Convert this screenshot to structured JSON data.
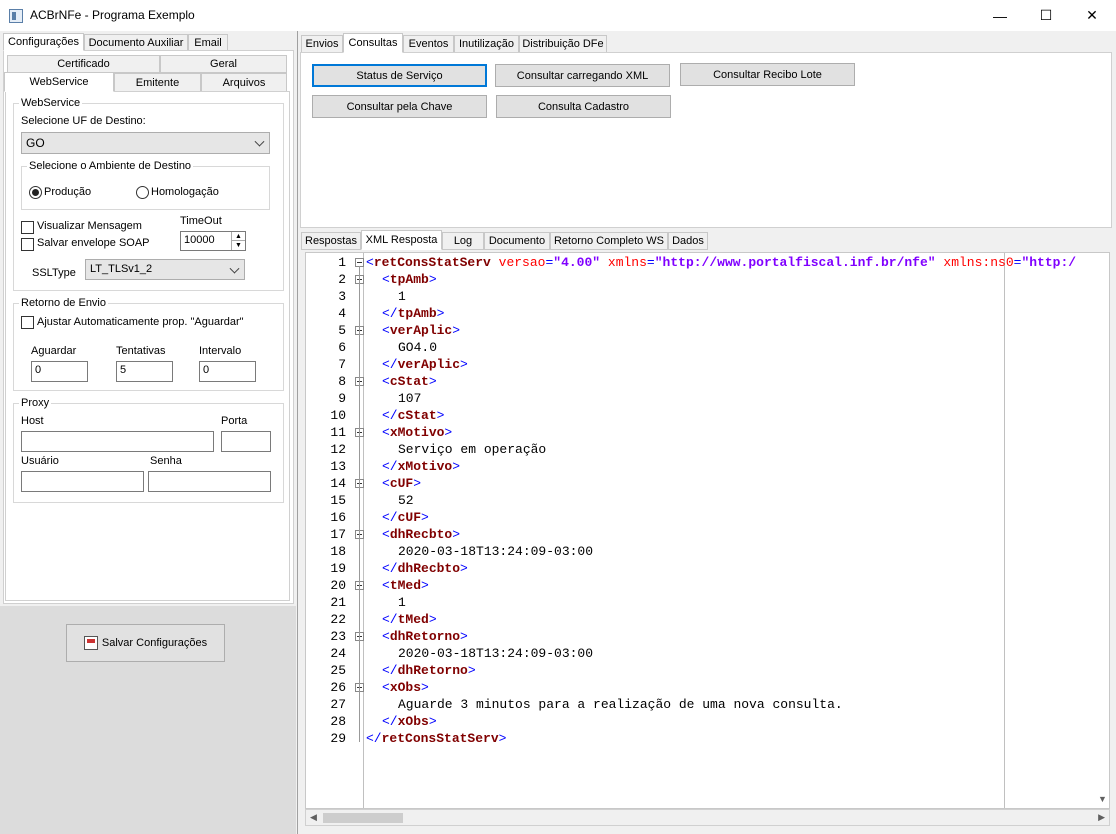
{
  "window": {
    "title": "ACBrNFe - Programa Exemplo",
    "minimize": "—",
    "maximize": "☐",
    "close": "✕"
  },
  "left_tabs": [
    "Configurações",
    "Documento Auxiliar",
    "Email"
  ],
  "config_tabs_row1": [
    "Certificado",
    "Geral"
  ],
  "config_tabs_row2": [
    "WebService",
    "Emitente",
    "Arquivos"
  ],
  "webservice": {
    "group": "WebService",
    "uf_label": "Selecione UF de Destino:",
    "uf_value": "GO",
    "ambiente_group": "Selecione o Ambiente de Destino",
    "producao": "Produção",
    "homologacao": "Homologação",
    "visualizar": "Visualizar Mensagem",
    "salvar_envelope": "Salvar envelope SOAP",
    "timeout_label": "TimeOut",
    "timeout_value": "10000",
    "ssltype_label": "SSLType",
    "ssltype_value": "LT_TLSv1_2"
  },
  "retorno": {
    "group": "Retorno de Envio",
    "ajustar": "Ajustar Automaticamente prop. \"Aguardar\"",
    "aguardar_label": "Aguardar",
    "aguardar_value": "0",
    "tentativas_label": "Tentativas",
    "tentativas_value": "5",
    "intervalo_label": "Intervalo",
    "intervalo_value": "0"
  },
  "proxy": {
    "group": "Proxy",
    "host": "Host",
    "porta": "Porta",
    "usuario": "Usuário",
    "senha": "Senha"
  },
  "salvar_button": "Salvar Configurações",
  "top_tabs": [
    "Envios",
    "Consultas",
    "Eventos",
    "Inutilização",
    "Distribuição DFe"
  ],
  "consultas_buttons": [
    "Status de Serviço",
    "Consultar carregando XML",
    "Consultar Recibo Lote",
    "Consultar pela Chave",
    "Consulta Cadastro"
  ],
  "result_tabs": [
    "Respostas",
    "XML Resposta",
    "Log",
    "Documento",
    "Retorno Completo WS",
    "Dados"
  ],
  "xml": {
    "root_open_tag": "retConsStatServ",
    "root_attrs": [
      {
        "name": "versao",
        "value": "\"4.00\""
      },
      {
        "name": "xmlns",
        "value": "\"http://www.portalfiscal.inf.br/nfe\""
      },
      {
        "name": "xmlns:ns0",
        "value": "\"http:/"
      }
    ],
    "elements": [
      {
        "tag": "tpAmb",
        "value": "1"
      },
      {
        "tag": "verAplic",
        "value": "GO4.0"
      },
      {
        "tag": "cStat",
        "value": "107"
      },
      {
        "tag": "xMotivo",
        "value": "Serviço em operação"
      },
      {
        "tag": "cUF",
        "value": "52"
      },
      {
        "tag": "dhRecbto",
        "value": "2020-03-18T13:24:09-03:00"
      },
      {
        "tag": "tMed",
        "value": "1"
      },
      {
        "tag": "dhRetorno",
        "value": "2020-03-18T13:24:09-03:00"
      },
      {
        "tag": "xObs",
        "value": "Aguarde 3 minutos para a realização de uma nova consulta."
      }
    ],
    "root_close_tag": "retConsStatServ"
  }
}
